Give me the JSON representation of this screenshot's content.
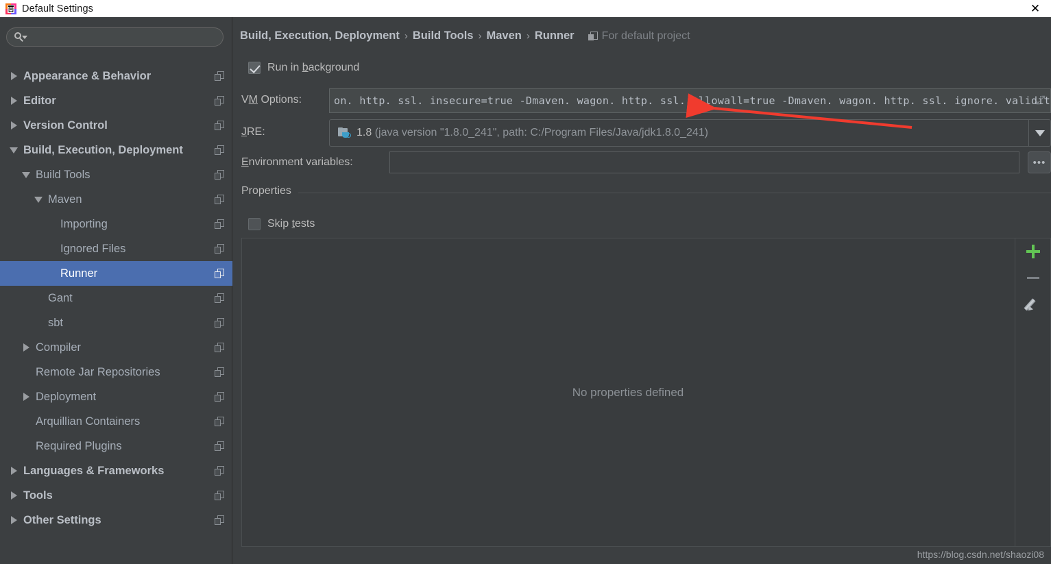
{
  "window": {
    "title": "Default Settings",
    "app_icon": "intellij-idea-icon",
    "close_label": "✕"
  },
  "search": {
    "placeholder": "",
    "value": "",
    "icon": "search-icon"
  },
  "sidebar": {
    "items": [
      {
        "label": "Appearance & Behavior",
        "indent": 0,
        "twisty": "right",
        "bold": true,
        "selected": false,
        "copy_icon": "copy-icon"
      },
      {
        "label": "Editor",
        "indent": 0,
        "twisty": "right",
        "bold": true,
        "selected": false,
        "copy_icon": "copy-icon"
      },
      {
        "label": "Version Control",
        "indent": 0,
        "twisty": "right",
        "bold": true,
        "selected": false,
        "copy_icon": "copy-icon"
      },
      {
        "label": "Build, Execution, Deployment",
        "indent": 0,
        "twisty": "down",
        "bold": true,
        "selected": false,
        "copy_icon": "copy-icon"
      },
      {
        "label": "Build Tools",
        "indent": 1,
        "twisty": "down",
        "bold": false,
        "selected": false,
        "copy_icon": "copy-icon"
      },
      {
        "label": "Maven",
        "indent": 2,
        "twisty": "down",
        "bold": false,
        "selected": false,
        "copy_icon": "copy-icon"
      },
      {
        "label": "Importing",
        "indent": 3,
        "twisty": "none",
        "bold": false,
        "selected": false,
        "copy_icon": "copy-icon"
      },
      {
        "label": "Ignored Files",
        "indent": 3,
        "twisty": "none",
        "bold": false,
        "selected": false,
        "copy_icon": "copy-icon"
      },
      {
        "label": "Runner",
        "indent": 3,
        "twisty": "none",
        "bold": false,
        "selected": true,
        "copy_icon": "copy-icon"
      },
      {
        "label": "Gant",
        "indent": 2,
        "twisty": "none",
        "bold": false,
        "selected": false,
        "copy_icon": "copy-icon"
      },
      {
        "label": "sbt",
        "indent": 2,
        "twisty": "none",
        "bold": false,
        "selected": false,
        "copy_icon": "copy-icon"
      },
      {
        "label": "Compiler",
        "indent": 1,
        "twisty": "right",
        "bold": false,
        "selected": false,
        "copy_icon": "copy-icon"
      },
      {
        "label": "Remote Jar Repositories",
        "indent": 1,
        "twisty": "none",
        "bold": false,
        "selected": false,
        "copy_icon": "copy-icon"
      },
      {
        "label": "Deployment",
        "indent": 1,
        "twisty": "right",
        "bold": false,
        "selected": false,
        "copy_icon": "copy-icon"
      },
      {
        "label": "Arquillian Containers",
        "indent": 1,
        "twisty": "none",
        "bold": false,
        "selected": false,
        "copy_icon": "copy-icon"
      },
      {
        "label": "Required Plugins",
        "indent": 1,
        "twisty": "none",
        "bold": false,
        "selected": false,
        "copy_icon": "copy-icon"
      },
      {
        "label": "Languages & Frameworks",
        "indent": 0,
        "twisty": "right",
        "bold": true,
        "selected": false,
        "copy_icon": "copy-icon"
      },
      {
        "label": "Tools",
        "indent": 0,
        "twisty": "right",
        "bold": true,
        "selected": false,
        "copy_icon": "copy-icon"
      },
      {
        "label": "Other Settings",
        "indent": 0,
        "twisty": "right",
        "bold": true,
        "selected": false,
        "copy_icon": "copy-icon"
      }
    ]
  },
  "breadcrumb": {
    "parts": [
      "Build, Execution, Deployment",
      "Build Tools",
      "Maven",
      "Runner"
    ],
    "separator": "›",
    "scope_label": "For default project",
    "scope_icon": "project-scope-icon"
  },
  "form": {
    "run_in_background": {
      "label_before": "Run in ",
      "mnemonic": "b",
      "label_after": "ackground",
      "checked": true
    },
    "vm_options": {
      "label_before": "V",
      "mnemonic": "M",
      "label_after": " Options:",
      "value": "on. http. ssl. insecure=true  -Dmaven. wagon. http. ssl. allowall=true  -Dmaven. wagon. http. ssl. ignore. validity. dates=true",
      "expand_icon": "expand-icon"
    },
    "jre": {
      "label_before": "",
      "mnemonic": "J",
      "label_after": "RE:",
      "value_version": "1.8",
      "value_detail": "(java version \"1.8.0_241\", path: C:/Program Files/Java/jdk1.8.0_241)",
      "icon": "jdk-folder-icon",
      "dropdown_icon": "chevron-down-icon"
    },
    "environment_variables": {
      "label_before": "",
      "mnemonic": "E",
      "label_after": "nvironment variables:",
      "value": "",
      "browse_label": "•••"
    },
    "properties_group": {
      "title": "Properties",
      "skip_tests": {
        "label_before": "Skip ",
        "mnemonic": "t",
        "label_after": "ests",
        "checked": false
      },
      "empty_text": "No properties defined",
      "toolbar": [
        {
          "name": "add-property-button",
          "icon": "plus-icon",
          "color": "#62c554"
        },
        {
          "name": "remove-property-button",
          "icon": "minus-icon",
          "color": "#7c8186"
        },
        {
          "name": "edit-property-button",
          "icon": "pencil-icon",
          "color": "#b7bcc1"
        }
      ]
    }
  },
  "watermark": {
    "text": "https://blog.csdn.net/shaozi08"
  },
  "annotation": {
    "arrow_color": "#f03b2e",
    "type": "red-arrow-pointing-left"
  },
  "colors": {
    "window_background": "#3c3f41",
    "titlebar_background": "#ffffff",
    "selection_blue": "#4b6eaf",
    "text_primary": "#bbbbbb",
    "text_muted": "#8c9196",
    "accent_green": "#62c554"
  }
}
